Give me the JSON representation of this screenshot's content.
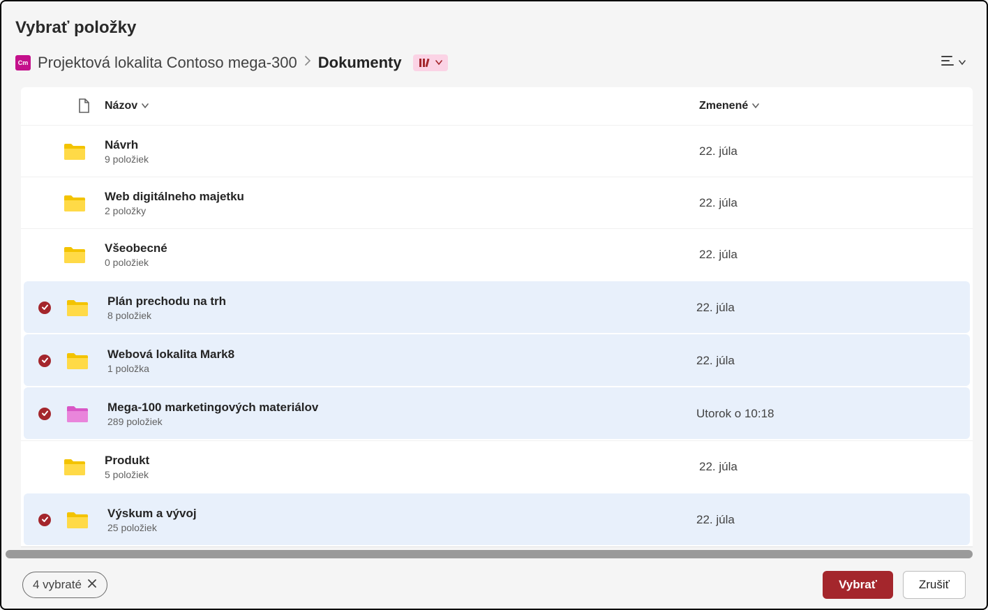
{
  "dialogTitle": "Vybrať položky",
  "breadcrumb": {
    "siteIconText": "Cm",
    "siteName": "Projektová lokalita Contoso mega-300",
    "current": "Dokumenty"
  },
  "columns": {
    "name": "Názov",
    "modified": "Zmenené"
  },
  "rows": [
    {
      "name": "Návrh",
      "meta": "9 položiek",
      "modified": "22. júla",
      "selected": false,
      "color": "yellow"
    },
    {
      "name": "Web digitálneho majetku",
      "meta": "2 položky",
      "modified": "22. júla",
      "selected": false,
      "color": "yellow"
    },
    {
      "name": "Všeobecné",
      "meta": "0 položiek",
      "modified": "22. júla",
      "selected": false,
      "color": "yellow"
    },
    {
      "name": "Plán prechodu na trh",
      "meta": "8 položiek",
      "modified": "22. júla",
      "selected": true,
      "color": "yellow"
    },
    {
      "name": "Webová lokalita Mark8",
      "meta": "1 položka",
      "modified": "22. júla",
      "selected": true,
      "color": "yellow"
    },
    {
      "name": "Mega-100 marketingových materiálov",
      "meta": "289 položiek",
      "modified": "Utorok o 10:18",
      "selected": true,
      "color": "pink"
    },
    {
      "name": "Produkt",
      "meta": "5 položiek",
      "modified": "22. júla",
      "selected": false,
      "color": "yellow"
    },
    {
      "name": "Výskum a vývoj",
      "meta": "25 položiek",
      "modified": "22. júla",
      "selected": true,
      "color": "yellow"
    }
  ],
  "footer": {
    "selectedLabel": "4 vybraté",
    "primary": "Vybrať",
    "secondary": "Zrušiť"
  }
}
